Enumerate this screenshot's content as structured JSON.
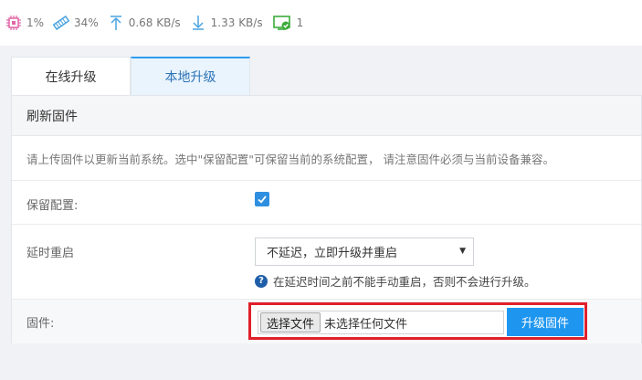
{
  "status": {
    "cpu": "1%",
    "memory": "34%",
    "upload": "0.68 KB/s",
    "download": "1.33 KB/s",
    "clients": "1"
  },
  "tabs": [
    {
      "label": "在线升级",
      "active": false
    },
    {
      "label": "本地升级",
      "active": true
    }
  ],
  "panel": {
    "title": "刷新固件",
    "description": "请上传固件以更新当前系统。选中\"保留配置\"可保留当前的系统配置， 请注意固件必须与当前设备兼容。",
    "keep_config_label": "保留配置:",
    "delay_label": "延时重启",
    "delay_value": "不延迟，立即升级并重启",
    "delay_hint": "在延迟时间之前不能手动重启，否则不会进行升级。",
    "firmware_label": "固件:",
    "choose_file_label": "选择文件",
    "no_file_text": "未选择任何文件",
    "upgrade_label": "升级固件"
  },
  "colors": {
    "accent": "#1e96f0",
    "highlight": "#e0202a",
    "status_icon": "#e065a5"
  }
}
